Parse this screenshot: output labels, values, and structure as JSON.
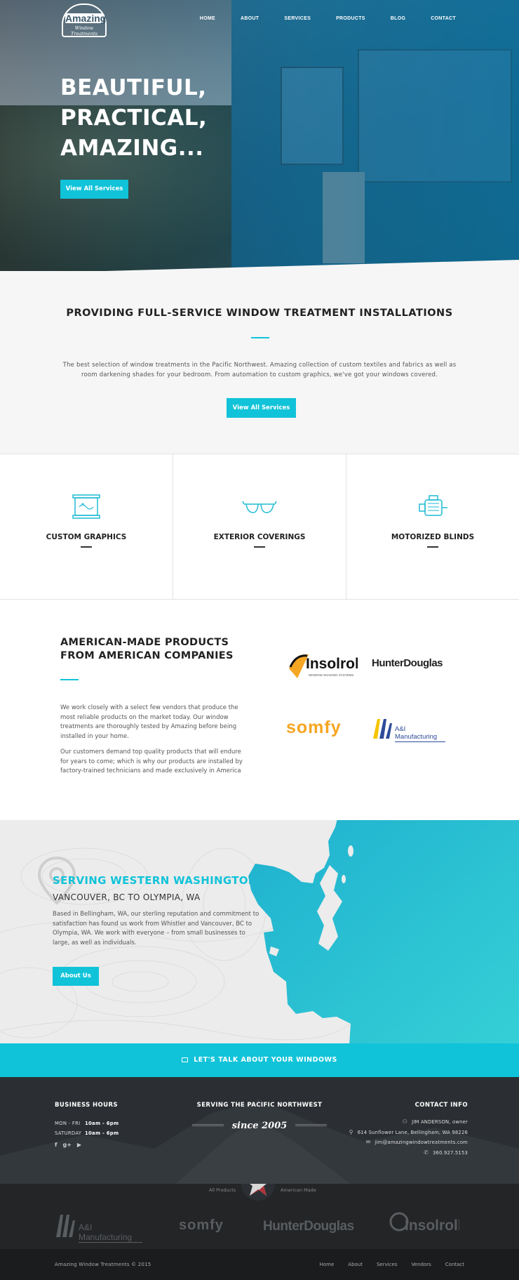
{
  "header": {
    "logo": {
      "name": "Amazing",
      "tagline": "Window Treatments"
    },
    "nav": [
      "HOME",
      "ABOUT",
      "SERVICES",
      "PRODUCTS",
      "BLOG",
      "CONTACT"
    ]
  },
  "hero": {
    "title_lines": [
      "BEAUTIFUL,",
      "PRACTICAL,",
      "AMAZING..."
    ],
    "button": "View All Services"
  },
  "intro": {
    "heading": "PROVIDING FULL-SERVICE WINDOW TREATMENT INSTALLATIONS",
    "body": "The best selection of window treatments in the Pacific Northwest. Amazing collection of custom textiles and fabrics as well as room darkening shades for your bedroom. From automation to custom graphics, we've got your windows covered.",
    "button": "View All Services"
  },
  "services": [
    {
      "title": "CUSTOM GRAPHICS",
      "icon": "banner-icon"
    },
    {
      "title": "EXTERIOR COVERINGS",
      "icon": "sunglasses-icon"
    },
    {
      "title": "MOTORIZED BLINDS",
      "icon": "motor-icon"
    }
  ],
  "products": {
    "heading": "AMERICAN-MADE PRODUCTS FROM AMERICAN COMPANIES",
    "p1": "We work closely with a select few vendors that produce the most reliable products on the market today. Our window treatments are thoroughly tested by Amazing before being installed in your home.",
    "p2": "Our customers demand top quality products that will endure for years to come; which is why our products are installed by factory-trained technicians and made exclusively in America",
    "brands": {
      "insolroll": "Insolroll",
      "insolroll_sub": "WINDOW SHADING SYSTEMS",
      "hunter": "HunterDouglas",
      "somfy": "somfy",
      "ai": "A&I Manufacturing"
    }
  },
  "serving": {
    "heading": "SERVING WESTERN WASHINGTON",
    "subheading": "VANCOUVER, BC TO OLYMPIA, WA",
    "body": "Based in Bellingham, WA, our sterling reputation and commitment to satisfaction has found us work from Whistler and Vancouver, BC to Olympia, WA. We work with everyone – from small businesses to large, as well as individuals.",
    "button": "About Us"
  },
  "cta": {
    "label": "LET'S TALK ABOUT YOUR WINDOWS"
  },
  "footer": {
    "hours_heading": "BUSINESS HOURS",
    "hours": [
      {
        "day": "MON - FRI",
        "time": "10am - 6pm"
      },
      {
        "day": "SATURDAY",
        "time": "10am - 6pm"
      }
    ],
    "social": [
      "f",
      "g+",
      "▶"
    ],
    "serving_heading": "SERVING THE PACIFIC NORTHWEST",
    "since": "since 2005",
    "contact_heading": "CONTACT INFO",
    "contact": {
      "person": "JIM ANDERSON, owner",
      "address": "614 Sunflower Lane, Bellingham, WA 98226",
      "email": "jim@amazingwindowtreatments.com",
      "phone": "360.927.5153"
    }
  },
  "vendors": {
    "label_left": "All Products",
    "label_right": "American Made",
    "brands": [
      "A&I Manufacturing",
      "somfy",
      "HunterDouglas",
      "Insolroll"
    ]
  },
  "bottom": {
    "copyright": "Amazing Window Treatments © 2015",
    "links": [
      "Home",
      "About",
      "Services",
      "Vendors",
      "Contact"
    ]
  },
  "colors": {
    "accent": "#10c3d9",
    "dark": "#2b2f33",
    "map": "#2bbcd0"
  }
}
